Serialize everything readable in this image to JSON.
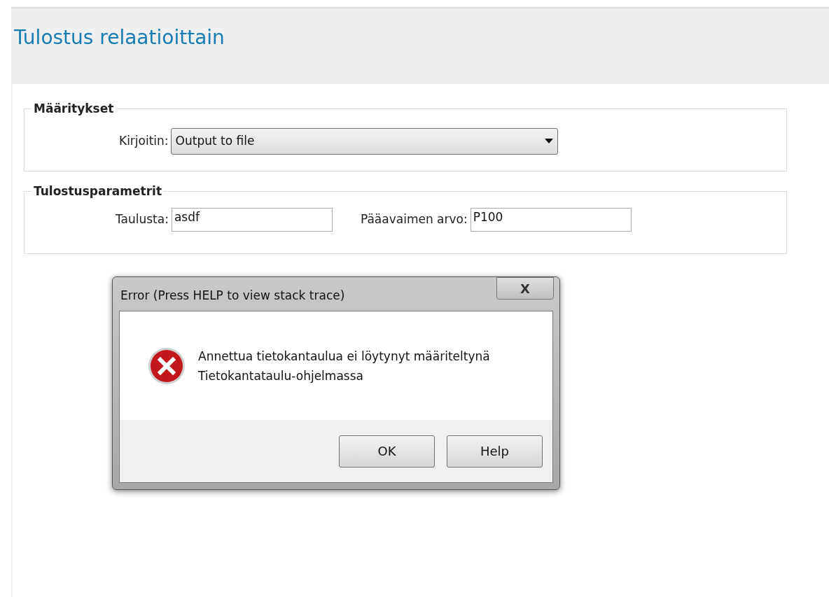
{
  "page": {
    "title": "Tulostus relaatioittain"
  },
  "sections": [
    {
      "legend": "Määritykset",
      "fields": [
        {
          "kind": "select",
          "label": "Kirjoitin:",
          "value": "Output to file"
        }
      ]
    },
    {
      "legend": "Tulostusparametrit",
      "fields": [
        {
          "kind": "text",
          "label": "Taulusta:",
          "value": "asdf"
        },
        {
          "kind": "text",
          "label": "Pääavaimen arvo:",
          "value": "P100"
        }
      ]
    }
  ],
  "dialog": {
    "title": "Error (Press HELP to view stack trace)",
    "close": "X",
    "message_lines": [
      "Annettua tietokantaulua ei löytynyt määriteltynä",
      "Tietokantataulu-ohjelmassa"
    ],
    "buttons": [
      "OK",
      "Help"
    ]
  }
}
